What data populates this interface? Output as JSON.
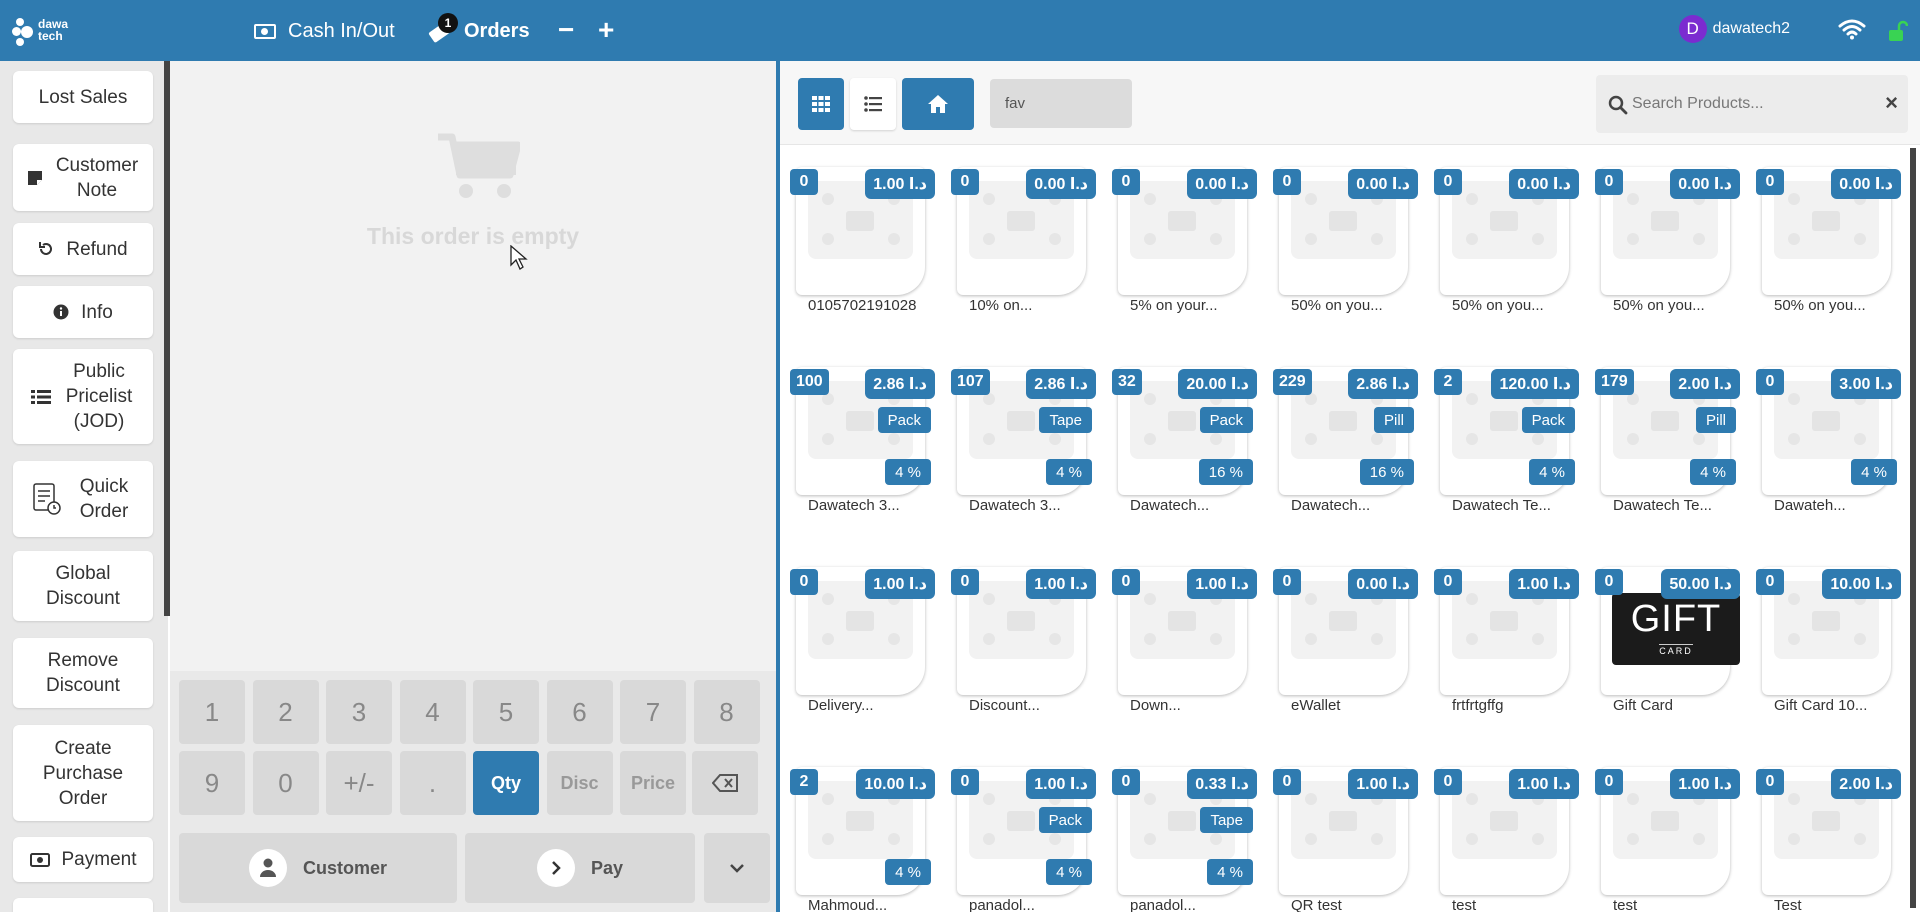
{
  "header": {
    "logo_text_1": "dawa",
    "logo_text_2": "tech",
    "cash_label": "Cash In/Out",
    "orders_label": "Orders",
    "orders_badge": "1",
    "minus": "−",
    "plus": "+",
    "user_initial": "D",
    "user_name": "dawatech2"
  },
  "actions": [
    {
      "label": "Lost Sales",
      "icon": ""
    },
    {
      "label": "Customer Note",
      "icon": "note-icon"
    },
    {
      "label": "Refund",
      "icon": "undo-icon"
    },
    {
      "label": "Info",
      "icon": "info-icon"
    },
    {
      "label": "Public Pricelist (JOD)",
      "icon": "list-icon"
    },
    {
      "label": "Quick Order",
      "icon": "quick-order-icon"
    },
    {
      "label": "Global Discount",
      "icon": ""
    },
    {
      "label": "Remove Discount",
      "icon": ""
    },
    {
      "label": "Create Purchase Order",
      "icon": ""
    },
    {
      "label": "Payment",
      "icon": "cash-icon"
    }
  ],
  "order": {
    "empty_text": "This order is empty"
  },
  "numpad": {
    "row1": [
      "1",
      "2",
      "3",
      "4",
      "5",
      "6",
      "7",
      "8"
    ],
    "row2": [
      "9",
      "0",
      "+/-",
      ".",
      "Qty",
      "Disc",
      "Price"
    ],
    "customer": "Customer",
    "pay": "Pay"
  },
  "toolbar": {
    "category": "fav",
    "search_placeholder": "Search Products...",
    "clear": "×"
  },
  "products": [
    {
      "qty": "0",
      "price": "1.00 د.ا",
      "name": "0105702191028"
    },
    {
      "qty": "0",
      "price": "0.00 د.ا",
      "name": "10% on..."
    },
    {
      "qty": "0",
      "price": "0.00 د.ا",
      "name": "5% on your..."
    },
    {
      "qty": "0",
      "price": "0.00 د.ا",
      "name": "50% on you..."
    },
    {
      "qty": "0",
      "price": "0.00 د.ا",
      "name": "50% on you..."
    },
    {
      "qty": "0",
      "price": "0.00 د.ا",
      "name": "50% on you..."
    },
    {
      "qty": "0",
      "price": "0.00 د.ا",
      "name": "50% on you..."
    },
    {
      "qty": "100",
      "price": "2.86 د.ا",
      "unit": "Pack",
      "tax": "4 %",
      "name": "Dawatech 3..."
    },
    {
      "qty": "107",
      "price": "2.86 د.ا",
      "unit": "Tape",
      "tax": "4 %",
      "name": "Dawatech 3..."
    },
    {
      "qty": "32",
      "price": "20.00 د.ا",
      "unit": "Pack",
      "tax": "16 %",
      "name": "Dawatech..."
    },
    {
      "qty": "229",
      "price": "2.86 د.ا",
      "unit": "Pill",
      "tax": "16 %",
      "name": "Dawatech..."
    },
    {
      "qty": "2",
      "price": "120.00 د.ا",
      "unit": "Pack",
      "tax": "4 %",
      "name": "Dawatech Te..."
    },
    {
      "qty": "179",
      "price": "2.00 د.ا",
      "unit": "Pill",
      "tax": "4 %",
      "name": "Dawatech Te..."
    },
    {
      "qty": "0",
      "price": "3.00 د.ا",
      "tax": "4 %",
      "name": "Dawateh..."
    },
    {
      "qty": "0",
      "price": "1.00 د.ا",
      "name": "Delivery..."
    },
    {
      "qty": "0",
      "price": "1.00 د.ا",
      "name": "Discount..."
    },
    {
      "qty": "0",
      "price": "1.00 د.ا",
      "name": "Down..."
    },
    {
      "qty": "0",
      "price": "0.00 د.ا",
      "name": "eWallet"
    },
    {
      "qty": "0",
      "price": "1.00 د.ا",
      "name": "frtfrtgffg"
    },
    {
      "qty": "0",
      "price": "50.00 د.ا",
      "name": "Gift Card",
      "gift": {
        "big": "GIFT",
        "small": "CARD"
      }
    },
    {
      "qty": "0",
      "price": "10.00 د.ا",
      "name": "Gift Card 10..."
    },
    {
      "qty": "2",
      "price": "10.00 د.ا",
      "tax": "4 %",
      "name": "Mahmoud..."
    },
    {
      "qty": "0",
      "price": "1.00 د.ا",
      "unit": "Pack",
      "tax": "4 %",
      "name": "panadol..."
    },
    {
      "qty": "0",
      "price": "0.33 د.ا",
      "unit": "Tape",
      "tax": "4 %",
      "name": "panadol..."
    },
    {
      "qty": "0",
      "price": "1.00 د.ا",
      "name": "QR test"
    },
    {
      "qty": "0",
      "price": "1.00 د.ا",
      "name": "test"
    },
    {
      "qty": "0",
      "price": "1.00 د.ا",
      "name": "test"
    },
    {
      "qty": "0",
      "price": "2.00 د.ا",
      "name": "Test"
    }
  ]
}
